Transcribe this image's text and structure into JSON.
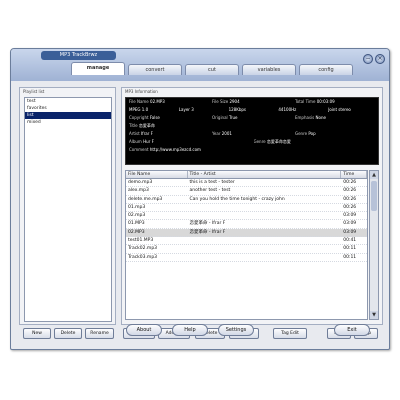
{
  "window": {
    "title": "MP3 TrackBrwz",
    "tabs": [
      "manage",
      "convert",
      "cut",
      "variables",
      "config"
    ],
    "active_tab": 0
  },
  "left_panel": {
    "title": "Playlist list",
    "items": [
      "test",
      "favorites",
      "list",
      "mixed"
    ],
    "selected_index": 2,
    "buttons": [
      "New",
      "Delete",
      "Rename"
    ]
  },
  "info": {
    "title": "MP3 Information",
    "rows": [
      [
        [
          "File Name",
          "02.MP3"
        ],
        [
          "File Size",
          "2904"
        ],
        [
          "Total Time",
          "00:03:09"
        ]
      ],
      [
        [
          "MPEG 1.0",
          ""
        ],
        [
          "Layer 3",
          ""
        ],
        [
          "128Kbps",
          ""
        ],
        [
          "44100Hz",
          ""
        ],
        [
          "Joint stereo",
          ""
        ]
      ],
      [
        [
          "Copyright",
          "False"
        ],
        [
          "Original",
          "True"
        ],
        [
          "Emphasis",
          "None"
        ]
      ],
      [
        [
          "Title",
          "恋愛革命"
        ],
        [
          "",
          ""
        ]
      ],
      [
        [
          "Artist",
          "Ifrar F"
        ],
        [
          "Year",
          "2001"
        ],
        [
          "Genre",
          "Pop"
        ]
      ],
      [
        [
          "Album",
          "Hur F"
        ],
        [
          "Genre",
          "恋愛革命恋愛"
        ]
      ],
      [
        [
          "Comment",
          "http://www.mp3ezcd.com"
        ]
      ]
    ]
  },
  "table": {
    "headers": [
      "File Name",
      "Title - Artist",
      "Time"
    ],
    "rows": [
      [
        "demo.mp3",
        "this is a test - tester",
        "00:26"
      ],
      [
        "alex.mp3",
        "another test - test",
        "00:26"
      ],
      [
        "delete.me.mp3",
        "Can you hold the time tonight - crazy john",
        "00:26"
      ],
      [
        "01.mp3",
        "",
        "00:26"
      ],
      [
        "02.mp3",
        "",
        "03:09"
      ],
      [
        "01.MP3",
        "恋愛革命 - Ifrar F",
        "03:09"
      ],
      [
        "02.MP3",
        "恋愛革命 - Ifrar F",
        "03:09"
      ],
      [
        "test01.MP3",
        "",
        "00:41"
      ],
      [
        "Track02.mp3",
        "",
        "00:11"
      ],
      [
        "Track03.mp3",
        "",
        "00:11"
      ]
    ],
    "selected_index": 6,
    "scroll_up": "▲",
    "scroll_down": "▼"
  },
  "table_buttons": [
    "Add MP3",
    "Add Dir",
    "Delete",
    "Clear",
    "Tag Edit",
    "Play",
    "Stop"
  ],
  "bottom_buttons": [
    "About",
    "Help",
    "Settings",
    "Exit"
  ],
  "window_controls": {
    "minimize": "−",
    "close": "×"
  }
}
